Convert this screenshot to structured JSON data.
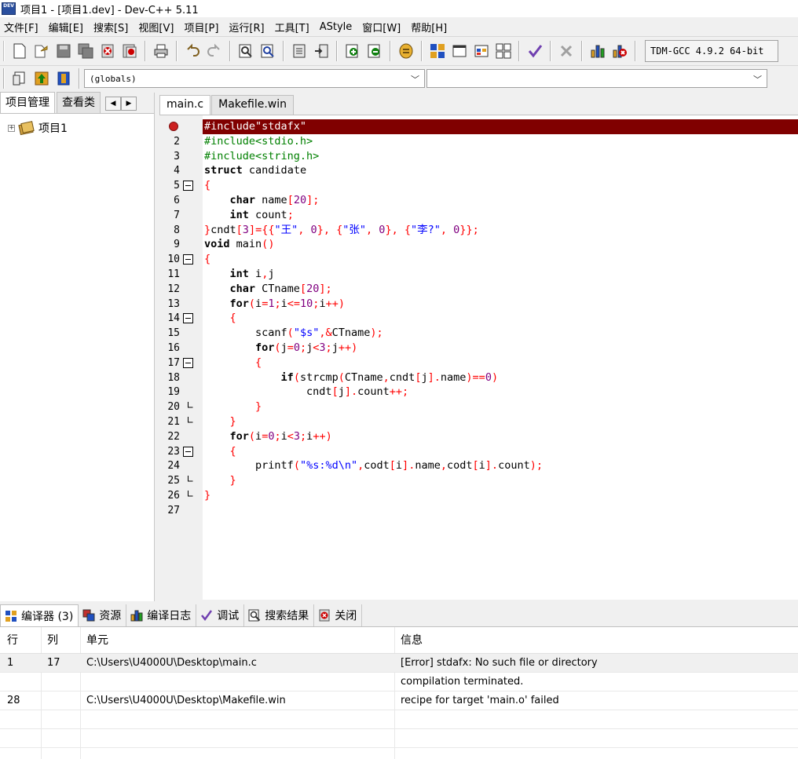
{
  "window": {
    "title": "项目1 - [项目1.dev] - Dev-C++ 5.11",
    "icon_text": "DEV"
  },
  "menu": [
    "文件[F]",
    "编辑[E]",
    "搜索[S]",
    "视图[V]",
    "项目[P]",
    "运行[R]",
    "工具[T]",
    "AStyle",
    "窗口[W]",
    "帮助[H]"
  ],
  "toolbar": {
    "compiler": "TDM-GCC 4.9.2 64-bit"
  },
  "toolbar2": {
    "scope_combo": "(globals)",
    "member_combo": ""
  },
  "left_panel": {
    "tabs": [
      "项目管理",
      "查看类"
    ],
    "tree_root": "项目1"
  },
  "editor": {
    "tabs": [
      "main.c",
      "Makefile.win"
    ],
    "error_line": 1,
    "lines": [
      "#include\"stdafx\"",
      "#include<stdio.h>",
      "#include<string.h>",
      "struct candidate",
      "{",
      "    char name[20];",
      "    int count;",
      "}cndt[3]={{\"王\", 0}, {\"张\", 0}, {\"李?\", 0}};",
      "void main()",
      "{",
      "    int i,j",
      "    char CTname[20];",
      "    for(i=1;i<=10;i++)",
      "    {",
      "        scanf(\"$s\",&CTname);",
      "        for(j=0;j<3;j++)",
      "        {",
      "            if(strcmp(CTname,cndt[j].name)==0)",
      "                cndt[j].count++;",
      "        }",
      "    }",
      "    for(i=0;i<3;i++)",
      "    {",
      "        printf(\"%s:%d\\n\",codt[i].name,codt[i].count);",
      "    }",
      "}",
      ""
    ]
  },
  "bottom_tabs": [
    "编译器 (3)",
    "资源",
    "编译日志",
    "调试",
    "搜索结果",
    "关闭"
  ],
  "results": {
    "headers": [
      "行",
      "列",
      "单元",
      "信息"
    ],
    "rows": [
      {
        "line": "1",
        "col": "17",
        "unit": "C:\\Users\\U4000U\\Desktop\\main.c",
        "message": "[Error] stdafx: No such file or directory"
      },
      {
        "line": "",
        "col": "",
        "unit": "",
        "message": "compilation terminated."
      },
      {
        "line": "28",
        "col": "",
        "unit": "C:\\Users\\U4000U\\Desktop\\Makefile.win",
        "message": "recipe for target 'main.o' failed"
      }
    ]
  },
  "colors": {
    "error_line_bg": "#800000",
    "preprocessor": "#008000",
    "string": "#0000ff",
    "number": "#800080",
    "symbol": "#ff0000"
  }
}
